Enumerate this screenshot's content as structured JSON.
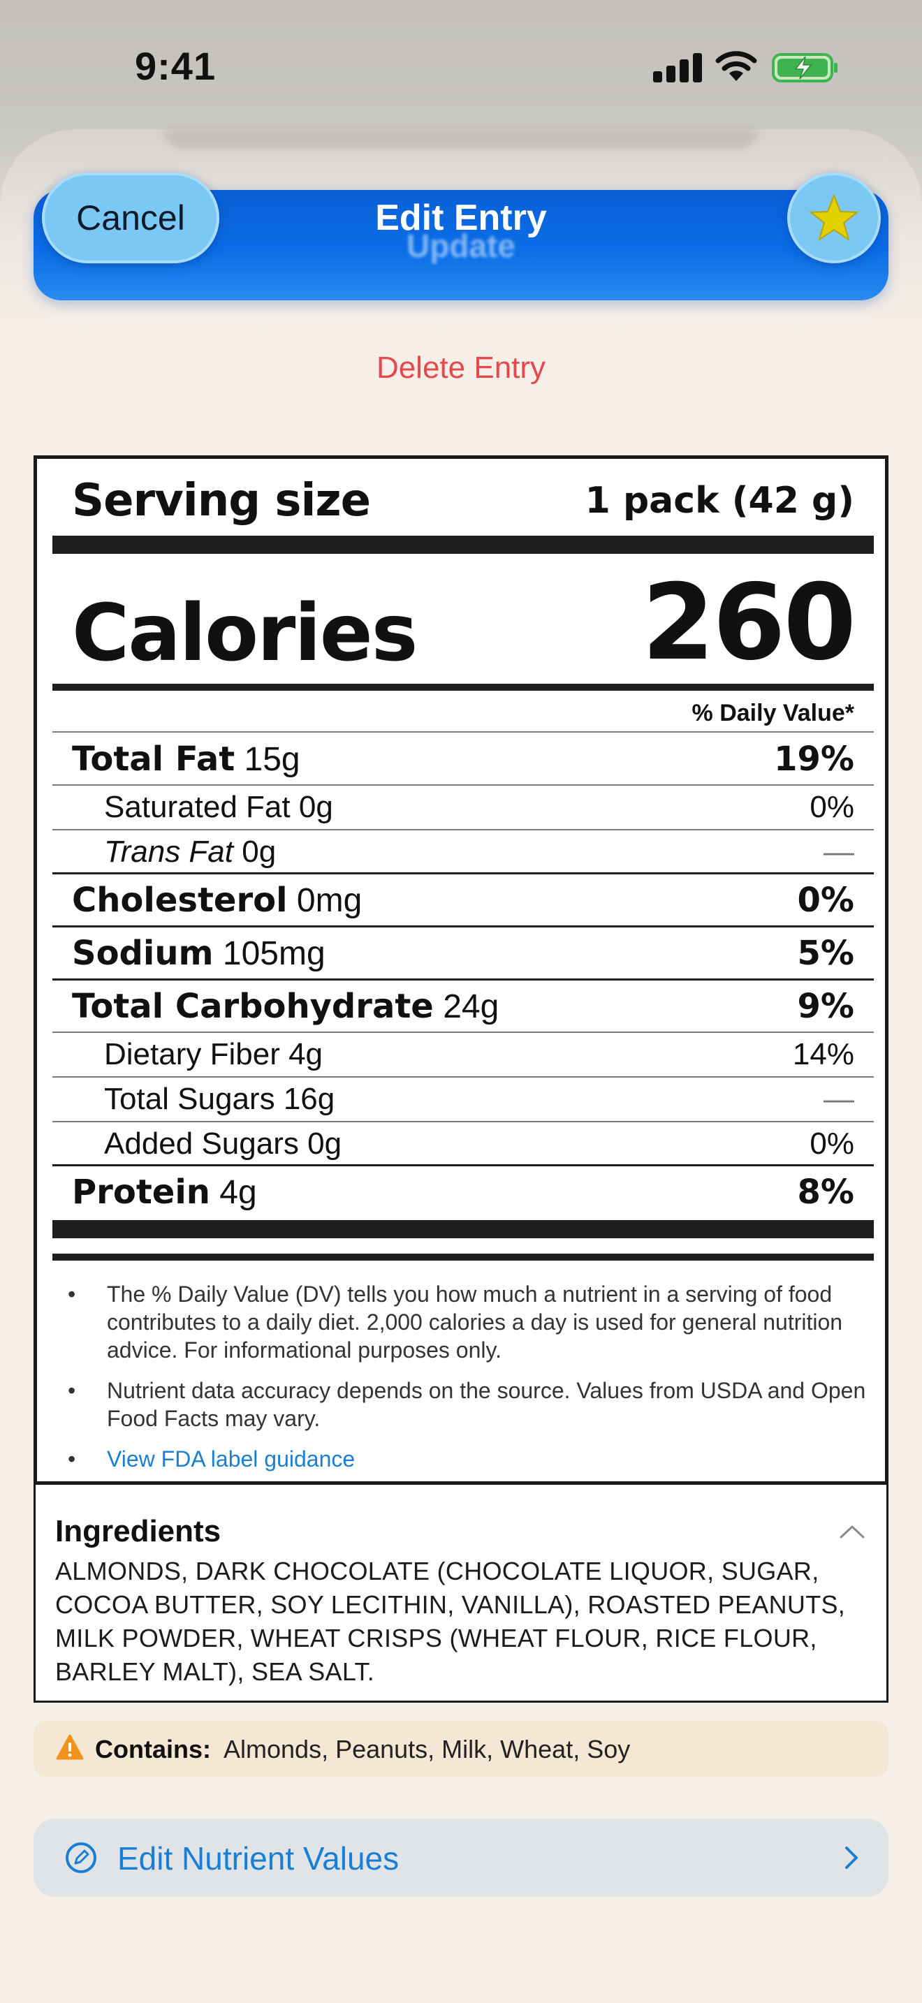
{
  "status_bar": {
    "time": "9:41"
  },
  "nav": {
    "cancel_label": "Cancel",
    "title": "Edit Entry",
    "subtitle": "Update",
    "favorite_icon": "star-icon"
  },
  "delete_label": "Delete Entry",
  "nutrition_label": {
    "serving_size_label": "Serving size",
    "serving_size_value": "1 pack (42 g)",
    "calories_label": "Calories",
    "calories_value": "260",
    "dv_header": "% Daily Value*",
    "nutrients": [
      {
        "name": "Total Fat",
        "amount": "15g",
        "dv": "19%"
      },
      {
        "name": "Saturated Fat",
        "amount": "0g",
        "dv": "0%"
      },
      {
        "name": "Trans Fat",
        "amount": "0g",
        "dv": "—"
      },
      {
        "name": "Cholesterol",
        "amount": "0mg",
        "dv": "0%"
      },
      {
        "name": "Sodium",
        "amount": "105mg",
        "dv": "5%"
      },
      {
        "name": "Total Carbohydrate",
        "amount": "24g",
        "dv": "9%"
      },
      {
        "name": "Dietary Fiber",
        "amount": "4g",
        "dv": "14%"
      },
      {
        "name": "Total Sugars",
        "amount": "16g",
        "dv": "—"
      },
      {
        "name": "Added Sugars",
        "amount": "0g",
        "dv": "0%"
      },
      {
        "name": "Protein",
        "amount": "4g",
        "dv": "8%"
      }
    ],
    "footnotes": [
      "The % Daily Value (DV) tells you how much a nutrient in a serving of food contributes to a daily diet. 2,000 calories a day is used for general nutrition advice. For informational purposes only.",
      "Nutrient data accuracy depends on the source. Values from USDA and Open Food Facts may vary."
    ],
    "fda_link": "View FDA label guidance"
  },
  "ingredients": {
    "title": "Ingredients",
    "text": "ALMONDS, DARK CHOCOLATE (CHOCOLATE LIQUOR, SUGAR, COCOA BUTTER, SOY LECITHIN, VANILLA), ROASTED PEANUTS, MILK POWDER, WHEAT CRISPS (WHEAT FLOUR, RICE FLOUR, BARLEY MALT), SEA SALT."
  },
  "allergens": {
    "label": "Contains:",
    "value": "Almonds, Peanuts, Milk, Wheat, Soy"
  },
  "edit_values_label": "Edit Nutrient Values",
  "colors": {
    "accent_blue": "#0a6ee8",
    "delete_red": "#e5484d",
    "link_blue": "#1a7fd4",
    "star_yellow": "#e2d000",
    "warning_orange": "#f0921c"
  }
}
